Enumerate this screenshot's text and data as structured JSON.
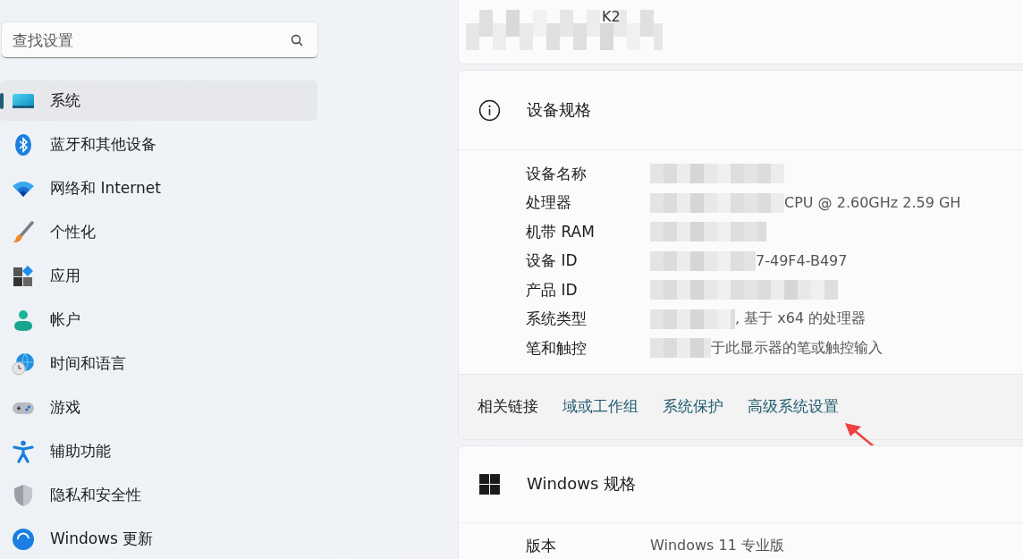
{
  "search": {
    "placeholder": "查找设置"
  },
  "sidebar": {
    "items": [
      {
        "label": "系统",
        "selected": true
      },
      {
        "label": "蓝牙和其他设备",
        "selected": false
      },
      {
        "label": "网络和 Internet",
        "selected": false
      },
      {
        "label": "个性化",
        "selected": false
      },
      {
        "label": "应用",
        "selected": false
      },
      {
        "label": "帐户",
        "selected": false
      },
      {
        "label": "时间和语言",
        "selected": false
      },
      {
        "label": "游戏",
        "selected": false
      },
      {
        "label": "辅助功能",
        "selected": false
      },
      {
        "label": "隐私和安全性",
        "selected": false
      },
      {
        "label": "Windows 更新",
        "selected": false
      }
    ]
  },
  "device_card": {
    "name_fragment": "K2"
  },
  "device_specs": {
    "title": "设备规格",
    "rows": [
      {
        "label": "设备名称"
      },
      {
        "label": "处理器",
        "value": "CPU @ 2.60GHz   2.59 GH"
      },
      {
        "label": "机带 RAM"
      },
      {
        "label": "设备 ID",
        "value": "7-49F4-B497"
      },
      {
        "label": "产品 ID"
      },
      {
        "label": "系统类型",
        "value": ", 基于 x64 的处理器"
      },
      {
        "label": "笔和触控",
        "value": "于此显示器的笔或触控输入"
      }
    ],
    "related_label": "相关链接",
    "related_links": [
      "域或工作组",
      "系统保护",
      "高级系统设置"
    ]
  },
  "windows_specs": {
    "title": "Windows 规格",
    "rows": [
      {
        "label": "版本",
        "value": "Windows 11 专业版"
      }
    ]
  }
}
